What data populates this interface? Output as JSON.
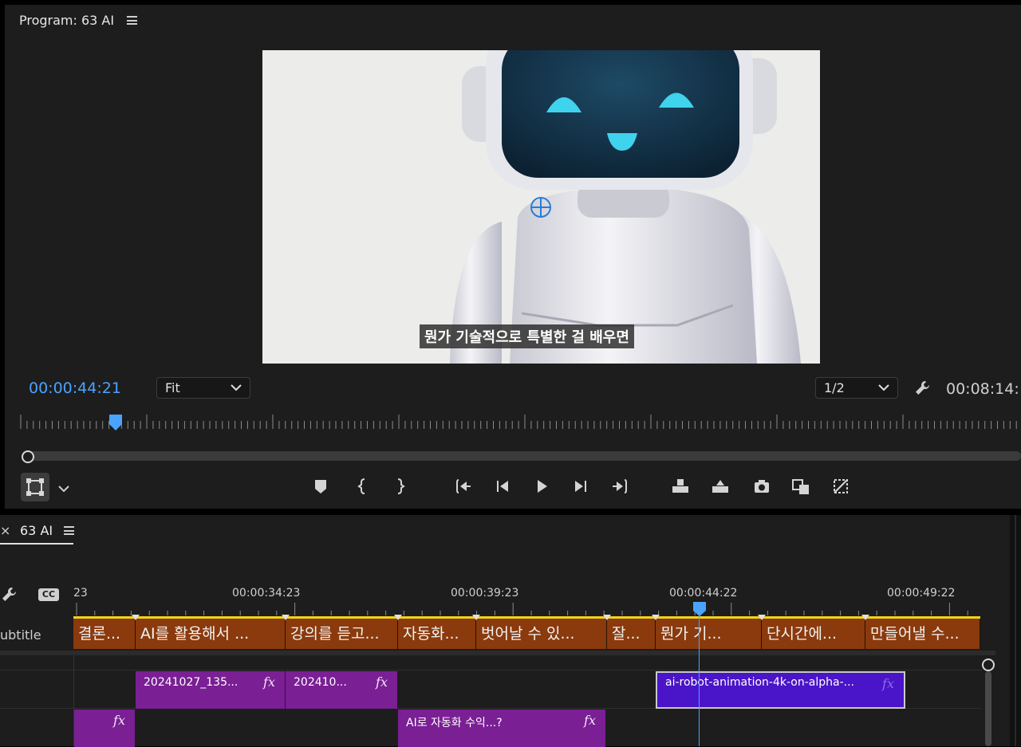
{
  "program": {
    "title": "Program: 63 AI",
    "caption": "뭔가 기술적으로 특별한 걸 배우면",
    "current_timecode": "00:00:44:21",
    "fit_label": "Fit",
    "resolution_label": "1/2",
    "duration_timecode": "00:08:14:",
    "playhead_percent": 9
  },
  "controls": [
    {
      "icon": "add-marker-icon"
    },
    {
      "icon": "mark-in-icon"
    },
    {
      "icon": "mark-out-icon"
    },
    {
      "icon": "go-to-in-icon"
    },
    {
      "icon": "step-back-icon"
    },
    {
      "icon": "play-icon"
    },
    {
      "icon": "step-forward-icon"
    },
    {
      "icon": "go-to-out-icon"
    },
    {
      "icon": "lift-icon"
    },
    {
      "icon": "extract-icon"
    },
    {
      "icon": "export-frame-icon"
    },
    {
      "icon": "insert-icon"
    },
    {
      "icon": "overwrite-icon"
    }
  ],
  "timeline": {
    "tab_label": "63 AI",
    "close_label": "×",
    "ruler_labels": [
      "23",
      "00:00:34:23",
      "00:00:39:23",
      "00:00:44:22",
      "00:00:49:22"
    ],
    "subtitle_track_label": "ubtitle",
    "subtitle_clips": [
      "결론...",
      "AI를 활용해서 ...",
      "강의를 듣고...",
      "자동화...",
      "벗어날 수 있...",
      "잘...",
      "뭔가 기...",
      "단시간에...",
      "만들어낼 수..."
    ],
    "video_clips": [
      {
        "label": "20241027_135...",
        "fx": "fx"
      },
      {
        "label": "202410...",
        "fx": "fx"
      },
      {
        "label": "ai-robot-animation-4k-on-alpha-...",
        "fx": "fx"
      }
    ],
    "lower_clips": [
      {
        "label": "",
        "fx": "fx"
      },
      {
        "label": "AI로 자동화 수익...?",
        "fx": "fx"
      }
    ]
  },
  "colors": {
    "accent_blue": "#4aa3ff",
    "subtitle_clip": "#8a3a0d",
    "video_clip_purple": "#7a1f94",
    "selected_clip": "#4a14c8",
    "work_area_yellow": "#f2d21b"
  }
}
